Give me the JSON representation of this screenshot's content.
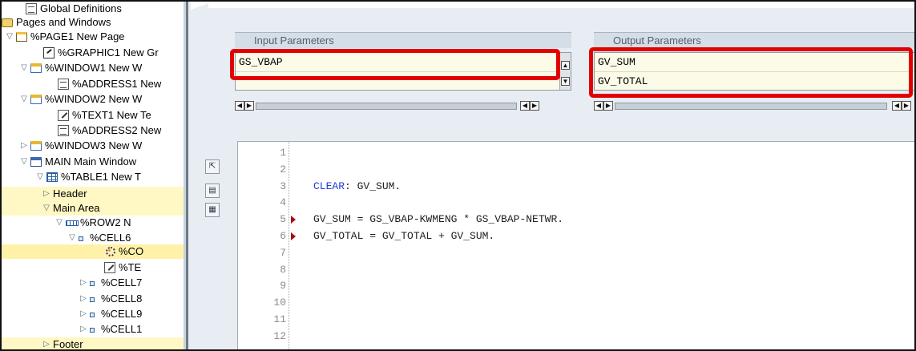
{
  "tree": {
    "items": [
      {
        "label": "Global Definitions",
        "icon": "document-icon",
        "expander": ""
      },
      {
        "label": "Pages and Windows",
        "icon": "folder-icon",
        "expander": "▽"
      },
      {
        "label": "%PAGE1 New Page",
        "icon": "page-icon",
        "expander": "▽"
      },
      {
        "label": "%GRAPHIC1 New Gr",
        "icon": "graphic-icon",
        "expander": ""
      },
      {
        "label": "%WINDOW1 New W",
        "icon": "window-icon",
        "expander": "▽"
      },
      {
        "label": "%ADDRESS1 New",
        "icon": "address-icon",
        "expander": ""
      },
      {
        "label": "%WINDOW2 New W",
        "icon": "window-icon",
        "expander": "▽"
      },
      {
        "label": "%TEXT1 New Te",
        "icon": "text-icon",
        "expander": ""
      },
      {
        "label": "%ADDRESS2 New",
        "icon": "address-icon",
        "expander": ""
      },
      {
        "label": "%WINDOW3 New W",
        "icon": "window-icon",
        "expander": "▷"
      },
      {
        "label": "MAIN Main Window",
        "icon": "main-window-icon",
        "expander": "▽"
      },
      {
        "label": "%TABLE1 New T",
        "icon": "table-icon",
        "expander": "▽"
      },
      {
        "label": "Header",
        "icon": "",
        "expander": "▷"
      },
      {
        "label": "Main Area",
        "icon": "",
        "expander": "▽"
      },
      {
        "label": "%ROW2 N",
        "icon": "row-icon",
        "expander": "▽"
      },
      {
        "label": "%CELL6",
        "icon": "cell-icon",
        "expander": "▽"
      },
      {
        "label": "%CO",
        "icon": "program-lines-icon",
        "expander": ""
      },
      {
        "label": "%TE",
        "icon": "text-icon",
        "expander": ""
      },
      {
        "label": "%CELL7",
        "icon": "cell-icon",
        "expander": "▷"
      },
      {
        "label": "%CELL8",
        "icon": "cell-icon",
        "expander": "▷"
      },
      {
        "label": "%CELL9",
        "icon": "cell-icon",
        "expander": "▷"
      },
      {
        "label": "%CELL1",
        "icon": "cell-icon",
        "expander": "▷"
      },
      {
        "label": "Footer",
        "icon": "",
        "expander": "▷"
      }
    ]
  },
  "input_params": {
    "header": "Input Parameters",
    "rows": [
      "GS_VBAP",
      ""
    ]
  },
  "output_params": {
    "header": "Output Parameters",
    "rows": [
      "GV_SUM",
      "GV_TOTAL"
    ]
  },
  "scroll_glyphs": {
    "left": "◀",
    "right": "▶",
    "up": "▲",
    "down": "▼"
  },
  "tools": [
    {
      "icon": "insert-line-icon",
      "glyph": "⇱"
    },
    {
      "icon": "pretty-print-icon",
      "glyph": "▤"
    },
    {
      "icon": "block-icon",
      "glyph": "▦"
    }
  ],
  "editor": {
    "lines": [
      {
        "no": "1",
        "text": "",
        "marked": false
      },
      {
        "no": "2",
        "text": "",
        "marked": false
      },
      {
        "no": "3",
        "kw": "CLEAR",
        "text": ": GV_SUM.",
        "marked": false
      },
      {
        "no": "4",
        "text": "",
        "marked": false
      },
      {
        "no": "5",
        "text": "GV_SUM = GS_VBAP-KWMENG * GS_VBAP-NETWR.",
        "marked": true
      },
      {
        "no": "6",
        "text": "GV_TOTAL = GV_TOTAL + GV_SUM.",
        "marked": true
      },
      {
        "no": "7",
        "text": "",
        "marked": false
      },
      {
        "no": "8",
        "text": "",
        "marked": false
      },
      {
        "no": "9",
        "text": "",
        "marked": false
      },
      {
        "no": "10",
        "text": "",
        "marked": false
      },
      {
        "no": "11",
        "text": "",
        "marked": false
      },
      {
        "no": "12",
        "text": "",
        "marked": false
      }
    ]
  },
  "colors": {
    "highlight": "#e30000",
    "keyword": "#1f3fd6",
    "selected_row": "#fff2a8"
  }
}
